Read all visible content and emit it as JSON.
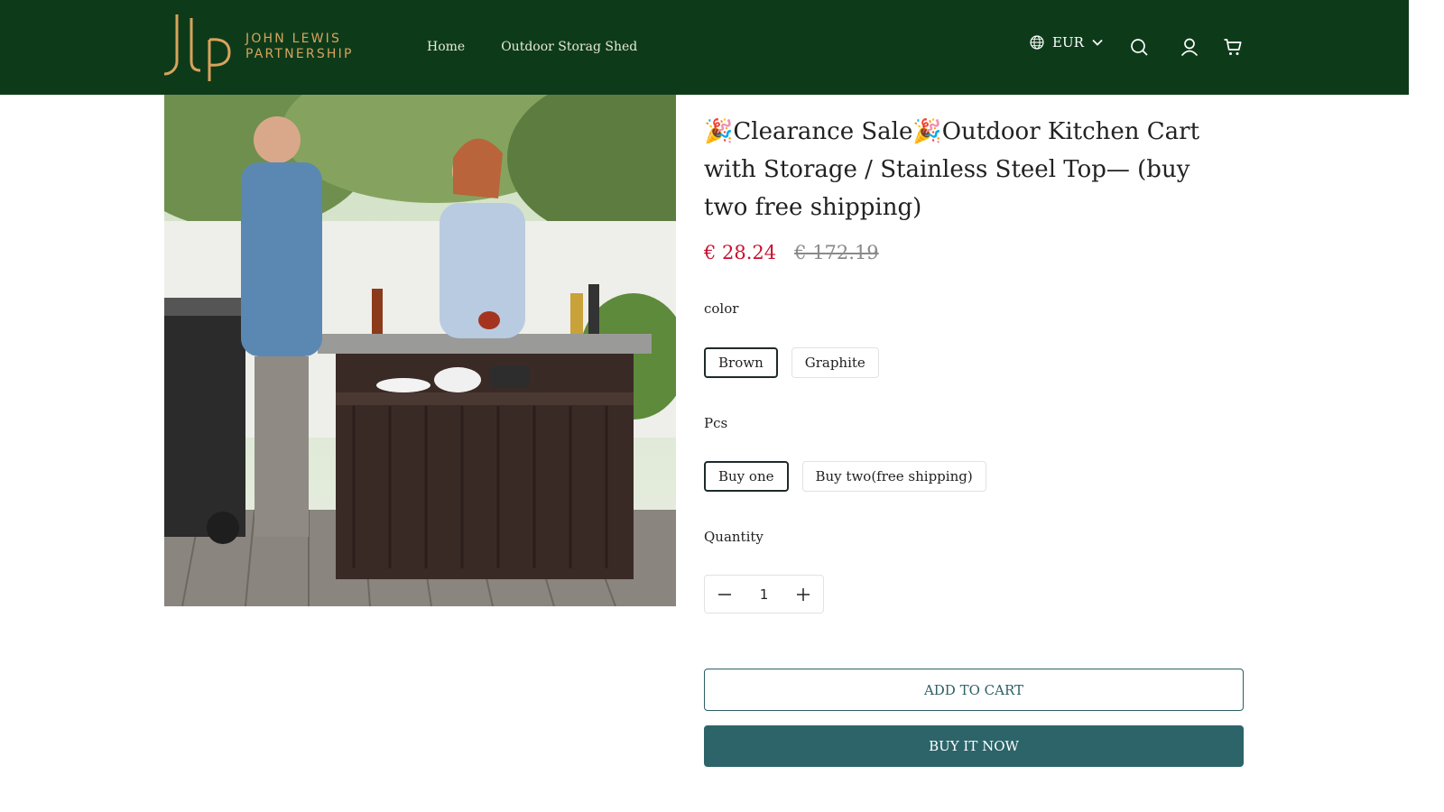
{
  "brand": {
    "line1": "JOHN LEWIS",
    "line2": "PARTNERSHIP",
    "logo_icon": "jlp-monogram-icon",
    "color": "#d9a35c"
  },
  "header": {
    "background": "#0d3b1a"
  },
  "nav": {
    "items": [
      {
        "label": "Home"
      },
      {
        "label": "Outdoor Storag Shed"
      }
    ]
  },
  "currency": {
    "value": "EUR"
  },
  "icons": {
    "globe": "globe-icon",
    "search": "search-icon",
    "account": "user-icon",
    "cart": "cart-icon"
  },
  "product": {
    "title": "🎉Clearance Sale🎉Outdoor Kitchen Cart with Storage / Stainless Steel Top— (buy two free shipping)",
    "price_sale": "€ 28.24",
    "price_original": "€ 172.19",
    "sale_color": "#c8102e",
    "image_alt": "Couple grilling beside outdoor kitchen cart"
  },
  "options": {
    "color": {
      "label": "color",
      "values": [
        "Brown",
        "Graphite"
      ],
      "selected": "Brown"
    },
    "pcs": {
      "label": "Pcs",
      "values": [
        "Buy one",
        "Buy two(free shipping)"
      ],
      "selected": "Buy one"
    }
  },
  "quantity": {
    "label": "Quantity",
    "value": "1"
  },
  "actions": {
    "add_to_cart": "ADD TO CART",
    "buy_now": "BUY IT NOW",
    "accent": "#2c6469"
  }
}
